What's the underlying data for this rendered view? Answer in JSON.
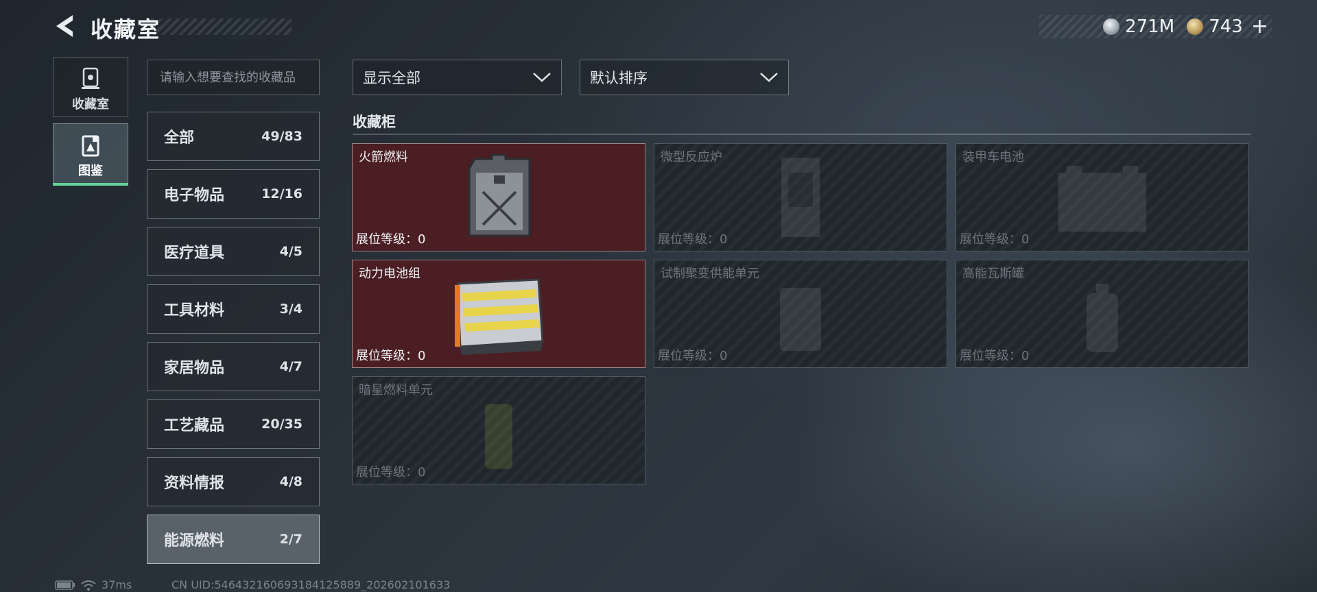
{
  "header": {
    "title": "收藏室"
  },
  "currency": {
    "silver": "271M",
    "gold": "743",
    "gold_plus": "+"
  },
  "nav": [
    {
      "label": "收藏室",
      "icon": "collection-room-icon",
      "active": false
    },
    {
      "label": "图鉴",
      "icon": "codex-icon",
      "active": true
    }
  ],
  "search": {
    "placeholder": "请输入想要查找的收藏品"
  },
  "categories": [
    {
      "name": "全部",
      "count": "49/83"
    },
    {
      "name": "电子物品",
      "count": "12/16"
    },
    {
      "name": "医疗道具",
      "count": "4/5"
    },
    {
      "name": "工具材料",
      "count": "3/4"
    },
    {
      "name": "家居物品",
      "count": "4/7"
    },
    {
      "name": "工艺藏品",
      "count": "20/35"
    },
    {
      "name": "资料情报",
      "count": "4/8"
    },
    {
      "name": "能源燃料",
      "count": "2/7"
    }
  ],
  "filters": {
    "show": "显示全部",
    "sort": "默认排序"
  },
  "section": {
    "title": "收藏柜"
  },
  "items": [
    {
      "name": "火箭燃料",
      "level": "展位等级：0",
      "owned": true
    },
    {
      "name": "微型反应炉",
      "level": "展位等级：0",
      "owned": false
    },
    {
      "name": "装甲车电池",
      "level": "展位等级：0",
      "owned": false
    },
    {
      "name": "动力电池组",
      "level": "展位等级：0",
      "owned": true
    },
    {
      "name": "试制聚变供能单元",
      "level": "展位等级：0",
      "owned": false
    },
    {
      "name": "高能瓦斯罐",
      "level": "展位等级：0",
      "owned": false
    },
    {
      "name": "暗星燃料单元",
      "level": "展位等级：0",
      "owned": false
    }
  ],
  "status": {
    "ping": "37ms",
    "uid": "CN UID:546432160693184125889_202602101633"
  }
}
